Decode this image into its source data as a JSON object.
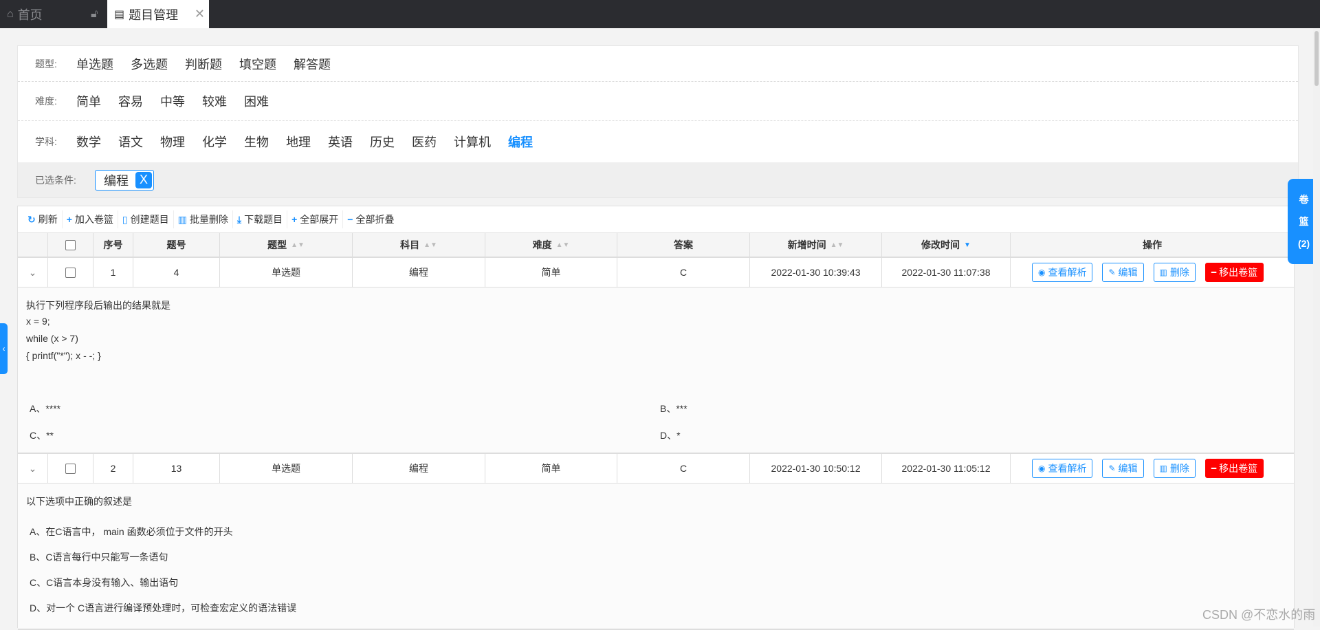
{
  "tabs": {
    "home": "首页",
    "active": "题目管理"
  },
  "filters": {
    "type_label": "题型:",
    "types": [
      "单选题",
      "多选题",
      "判断题",
      "填空题",
      "解答题"
    ],
    "difficulty_label": "难度:",
    "difficulties": [
      "简单",
      "容易",
      "中等",
      "较难",
      "困难"
    ],
    "subject_label": "学科:",
    "subjects": [
      "数学",
      "语文",
      "物理",
      "化学",
      "生物",
      "地理",
      "英语",
      "历史",
      "医药",
      "计算机",
      "编程"
    ],
    "active_subject": "编程",
    "selected_label": "已选条件:",
    "selected_chip": "编程",
    "chip_close": "X"
  },
  "toolbar": {
    "refresh": "刷新",
    "add_basket": "加入卷篮",
    "create": "创建题目",
    "batch_delete": "批量删除",
    "download": "下载题目",
    "expand_all": "全部展开",
    "collapse_all": "全部折叠"
  },
  "table": {
    "headers": {
      "index": "序号",
      "qid": "题号",
      "qtype": "题型",
      "subject": "科目",
      "difficulty": "难度",
      "answer": "答案",
      "created": "新增时间",
      "modified": "修改时间",
      "ops": "操作"
    },
    "rows": [
      {
        "index": "1",
        "qid": "4",
        "qtype": "单选题",
        "subject": "编程",
        "difficulty": "简单",
        "answer": "C",
        "created": "2022-01-30 10:39:43",
        "modified": "2022-01-30 11:07:38",
        "stem": [
          "执行下列程序段后输出的结果就是",
          "x = 9;",
          "while (x > 7)",
          "{ printf(\"*\"); x - -; }"
        ],
        "options": [
          "A、****",
          "B、***",
          "C、**",
          "D、*"
        ]
      },
      {
        "index": "2",
        "qid": "13",
        "qtype": "单选题",
        "subject": "编程",
        "difficulty": "简单",
        "answer": "C",
        "created": "2022-01-30 10:50:12",
        "modified": "2022-01-30 11:05:12",
        "stem": [
          "以下选项中正确的叙述是"
        ],
        "options": [
          "A、在C语言中， main 函数必须位于文件的开头",
          "B、C语言每行中只能写一条语句",
          "C、C语言本身没有输入、输出语句",
          "D、对一个 C语言进行编译预处理时，可检查宏定义的语法错误"
        ]
      }
    ],
    "buttons": {
      "view": "查看解析",
      "edit": "编辑",
      "delete": "删除",
      "remove": "移出卷篮"
    }
  },
  "side_panel": {
    "line1": "卷",
    "line2": "篮",
    "count": "(2)"
  },
  "watermark": "CSDN @不恋水的雨"
}
